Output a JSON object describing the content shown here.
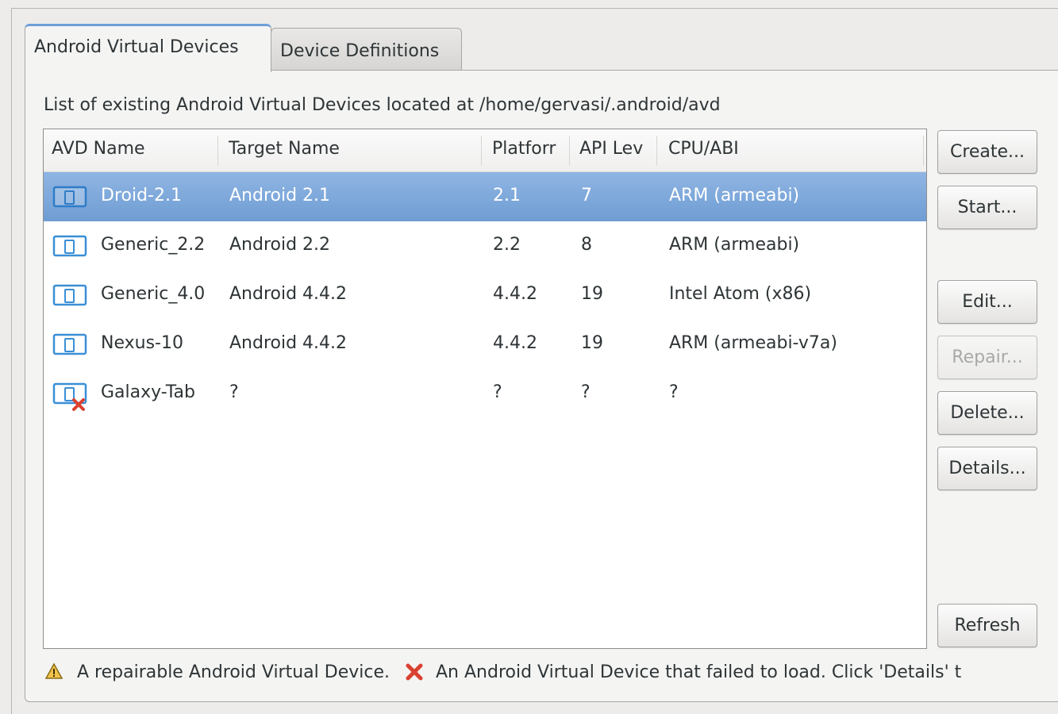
{
  "tabs": [
    {
      "label": "Android Virtual Devices",
      "active": true
    },
    {
      "label": "Device Definitions",
      "active": false
    }
  ],
  "info_text": "List of existing Android Virtual Devices located at /home/gervasi/.android/avd",
  "table": {
    "columns": [
      "AVD Name",
      "Target Name",
      "Platforr",
      "API Lev",
      "CPU/ABI"
    ],
    "rows": [
      {
        "name": "Droid-2.1",
        "target": "Android 2.1",
        "platform": "2.1",
        "api": "7",
        "cpu": "ARM (armeabi)",
        "icon": "device-icon",
        "selected": true
      },
      {
        "name": "Generic_2.2",
        "target": "Android 2.2",
        "platform": "2.2",
        "api": "8",
        "cpu": "ARM (armeabi)",
        "icon": "device-icon",
        "selected": false
      },
      {
        "name": "Generic_4.0",
        "target": "Android 4.4.2",
        "platform": "4.4.2",
        "api": "19",
        "cpu": "Intel Atom (x86)",
        "icon": "device-icon",
        "selected": false
      },
      {
        "name": "Nexus-10",
        "target": "Android 4.4.2",
        "platform": "4.4.2",
        "api": "19",
        "cpu": "ARM (armeabi-v7a)",
        "icon": "device-icon",
        "selected": false
      },
      {
        "name": "Galaxy-Tab",
        "target": "?",
        "platform": "?",
        "api": "?",
        "cpu": "?",
        "icon": "device-error-icon",
        "selected": false
      }
    ]
  },
  "buttons": {
    "create": "Create...",
    "start": "Start...",
    "edit": "Edit...",
    "repair": "Repair...",
    "delete": "Delete...",
    "details": "Details...",
    "refresh": "Refresh"
  },
  "legend": {
    "repairable": "A repairable Android Virtual Device.",
    "failed": "An Android Virtual Device that failed to load. Click 'Details' t"
  },
  "colors": {
    "selection": "#7aa6da",
    "tab_accent": "#6d9fd8",
    "error_x": "#d9412f",
    "device_icon": "#3a8fd6"
  }
}
